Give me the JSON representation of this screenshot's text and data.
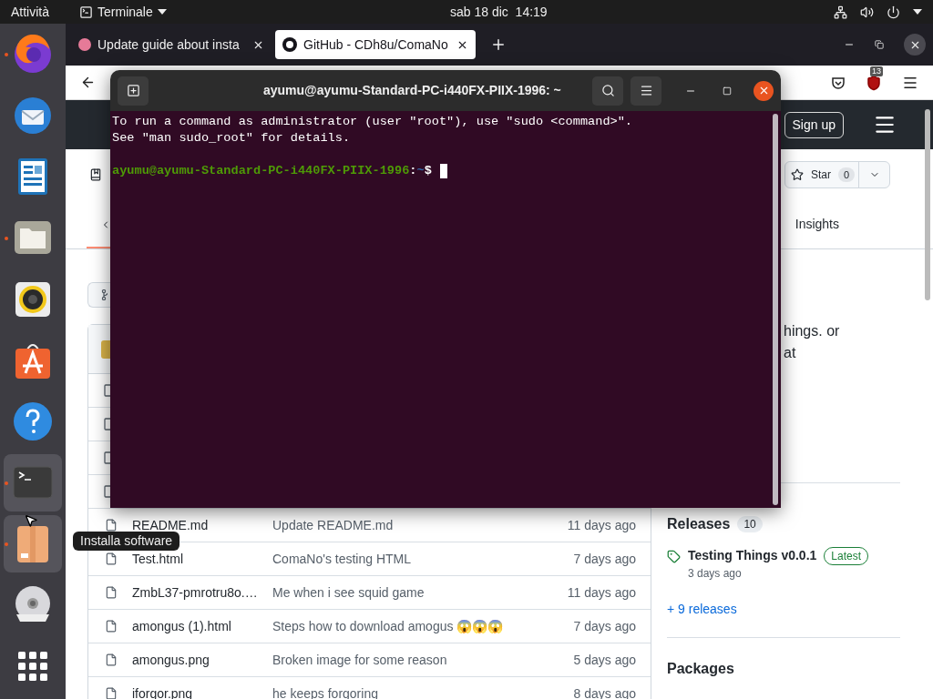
{
  "top_bar": {
    "activities": "Attività",
    "app_menu": "Terminale",
    "clock": "sab 18 dic  14:19"
  },
  "dock": [
    {
      "kind": "browser",
      "running": true,
      "highlighted": false
    },
    {
      "kind": "mail",
      "running": false,
      "highlighted": false
    },
    {
      "kind": "document",
      "running": false,
      "highlighted": false
    },
    {
      "kind": "folder",
      "running": true,
      "highlighted": false
    },
    {
      "kind": "music",
      "running": false,
      "highlighted": false
    },
    {
      "kind": "store",
      "running": false,
      "highlighted": false
    },
    {
      "kind": "help",
      "running": false,
      "highlighted": false
    },
    {
      "kind": "terminal",
      "running": true,
      "highlighted": true
    },
    {
      "kind": "package",
      "running": true,
      "highlighted": true
    },
    {
      "kind": "disc",
      "running": false,
      "highlighted": false
    },
    {
      "kind": "apps",
      "running": false,
      "highlighted": false
    }
  ],
  "tooltip": "Installa software",
  "browser": {
    "tabs": [
      {
        "title": "Update guide about insta",
        "selected": false
      },
      {
        "title": "GitHub - CDh8u/ComaNo",
        "selected": true
      }
    ],
    "extension_badge": "13"
  },
  "github": {
    "sign_up": "Sign up",
    "star": {
      "label": "Star",
      "count": "0"
    },
    "tab": "Insights",
    "about_lines": [
      "hings. or",
      "at"
    ],
    "files": [
      {
        "kind": "covered"
      },
      {
        "kind": "covered"
      },
      {
        "kind": "covered"
      },
      {
        "kind": "covered"
      },
      {
        "kind": "file",
        "name": "README.md",
        "message": "Update README.md",
        "age": "11 days ago"
      },
      {
        "kind": "file",
        "name": "Test.html",
        "message": "ComaNo's testing HTML",
        "age": "7 days ago"
      },
      {
        "kind": "file",
        "name": "ZmbL37-pmrotru8o.…",
        "message": "Me when i see squid game",
        "age": "11 days ago"
      },
      {
        "kind": "file",
        "name": "amongus (1).html",
        "message": "Steps how to download amogus 😱😱😱",
        "age": "7 days ago"
      },
      {
        "kind": "file",
        "name": "amongus.png",
        "message": "Broken image for some reason",
        "age": "5 days ago"
      },
      {
        "kind": "file",
        "name": "iforgor.png",
        "message": "he keeps forgoring",
        "age": "8 days ago"
      }
    ],
    "releases": {
      "title": "Releases",
      "count": "10",
      "latest": {
        "name": "Testing Things v0.0.1",
        "badge": "Latest",
        "age": "3 days ago"
      },
      "more": "+ 9 releases"
    },
    "packages_title": "Packages"
  },
  "terminal": {
    "title": "ayumu@ayumu-Standard-PC-i440FX-PIIX-1996: ~",
    "lines": [
      "To run a command as administrator (user \"root\"), use \"sudo <command>\".",
      "See \"man sudo_root\" for details."
    ],
    "prompt": {
      "user_host": "ayumu@ayumu-Standard-PC-i440FX-PIIX-1996",
      "separator": ":",
      "path": "~",
      "symbol": "$"
    }
  }
}
